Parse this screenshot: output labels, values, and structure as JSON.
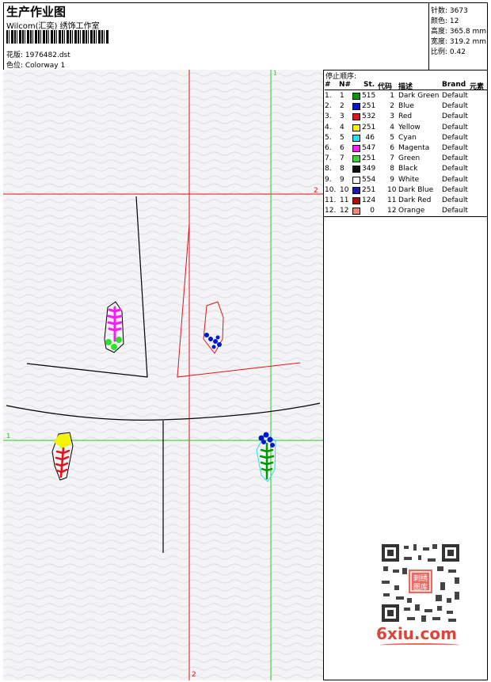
{
  "header": {
    "title": "生产作业图",
    "studio": "Wilcom(汇奕) 绣饰工作室",
    "design_label": "花版: 1976482.dst",
    "colorway_label": "色位:  Colorway 1"
  },
  "stats": {
    "stitches": "针数: 3673",
    "colors": "颜色: 12",
    "height": "高度: 365.8 mm",
    "width": "宽度: 319.2 mm",
    "scale": "比例: 0.42"
  },
  "stop_sequence": {
    "title": "停止顺序:",
    "headers": {
      "stop": "#",
      "needle": "N#",
      "st": "St.",
      "code": "代码",
      "desc": "描述",
      "brand": "Brand",
      "element": "元素"
    },
    "rows": [
      {
        "stop": "1.",
        "needle": "1",
        "color": "#009a00",
        "st": "515",
        "code": "1",
        "desc": "Dark Green",
        "brand": "Default"
      },
      {
        "stop": "2.",
        "needle": "2",
        "color": "#0018c8",
        "st": "251",
        "code": "2",
        "desc": "Blue",
        "brand": "Default"
      },
      {
        "stop": "3.",
        "needle": "3",
        "color": "#e0141a",
        "st": "532",
        "code": "3",
        "desc": "Red",
        "brand": "Default"
      },
      {
        "stop": "4.",
        "needle": "4",
        "color": "#f2f20a",
        "st": "251",
        "code": "4",
        "desc": "Yellow",
        "brand": "Default"
      },
      {
        "stop": "5.",
        "needle": "5",
        "color": "#22e0ee",
        "st": "46",
        "code": "5",
        "desc": "Cyan",
        "brand": "Default"
      },
      {
        "stop": "6.",
        "needle": "6",
        "color": "#f21ef2",
        "st": "547",
        "code": "6",
        "desc": "Magenta",
        "brand": "Default"
      },
      {
        "stop": "7.",
        "needle": "7",
        "color": "#2fe02a",
        "st": "251",
        "code": "7",
        "desc": "Green",
        "brand": "Default"
      },
      {
        "stop": "8.",
        "needle": "8",
        "color": "#111111",
        "st": "349",
        "code": "8",
        "desc": "Black",
        "brand": "Default"
      },
      {
        "stop": "9.",
        "needle": "9",
        "color": "#ffffff",
        "st": "554",
        "code": "9",
        "desc": "White",
        "brand": "Default"
      },
      {
        "stop": "10.",
        "needle": "10",
        "color": "#1a1ab8",
        "st": "251",
        "code": "10",
        "desc": "Dark Blue",
        "brand": "Default"
      },
      {
        "stop": "11.",
        "needle": "11",
        "color": "#b00c0c",
        "st": "124",
        "code": "11",
        "desc": "Dark Red",
        "brand": "Default"
      },
      {
        "stop": "12.",
        "needle": "12",
        "color": "#f08a7a",
        "st": "0",
        "code": "12",
        "desc": "Orange",
        "brand": "Default"
      }
    ]
  },
  "canvas": {
    "axis_labels": {
      "green_top": "1",
      "red_right": "2",
      "green_left": "1",
      "red_bottom": "2"
    }
  },
  "watermark": {
    "qr_stamp": "刺绣图库",
    "site": "6xiu.com"
  }
}
